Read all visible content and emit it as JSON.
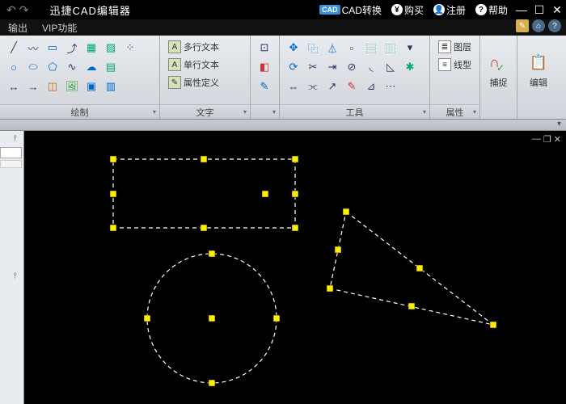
{
  "app": {
    "title": "迅捷CAD编辑器"
  },
  "titlebar": {
    "cad_convert": "CAD转换",
    "buy": "购买",
    "register": "注册",
    "help": "帮助"
  },
  "menubar": {
    "output": "输出",
    "vip": "VIP功能"
  },
  "ribbon": {
    "draw": {
      "label": "绘制"
    },
    "text": {
      "label": "文字",
      "multiline": "多行文本",
      "singleline": "单行文本",
      "attrdef": "属性定义"
    },
    "tools": {
      "label": "工具"
    },
    "properties": {
      "label": "属性",
      "layer": "图层",
      "linetype": "线型"
    },
    "snap": {
      "label": "捕捉"
    },
    "edit": {
      "label": "编辑"
    }
  },
  "canvas": {
    "shapes": [
      {
        "type": "rectangle"
      },
      {
        "type": "circle"
      },
      {
        "type": "triangle"
      }
    ]
  }
}
